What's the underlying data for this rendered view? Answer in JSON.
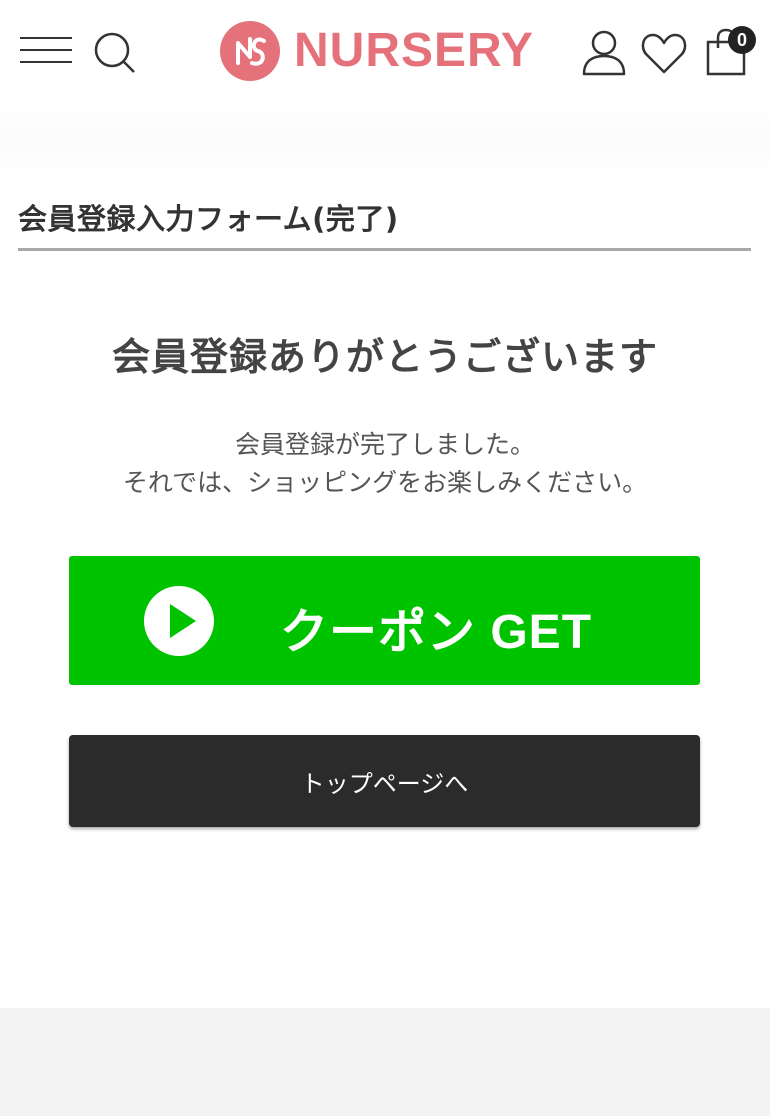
{
  "header": {
    "logo_text": "NURSERY",
    "menu_icon": "hamburger-menu-icon",
    "search_icon": "search-icon",
    "account_icon": "user-icon",
    "favorites_icon": "heart-icon",
    "cart_icon": "shopping-bag-icon",
    "cart_count": "0",
    "brand_color": "#e5727b"
  },
  "page": {
    "section_title": "会員登録入力フォーム(完了)",
    "thanks_heading": "会員登録ありがとうございます",
    "message_line1": "会員登録が完了しました。",
    "message_line2": "それでは、ショッピングをお楽しみください。"
  },
  "buttons": {
    "coupon_label": "クーポン GET",
    "coupon_color": "#00c300",
    "top_page_label": "トップページへ",
    "top_page_color": "#2b2b2b"
  }
}
